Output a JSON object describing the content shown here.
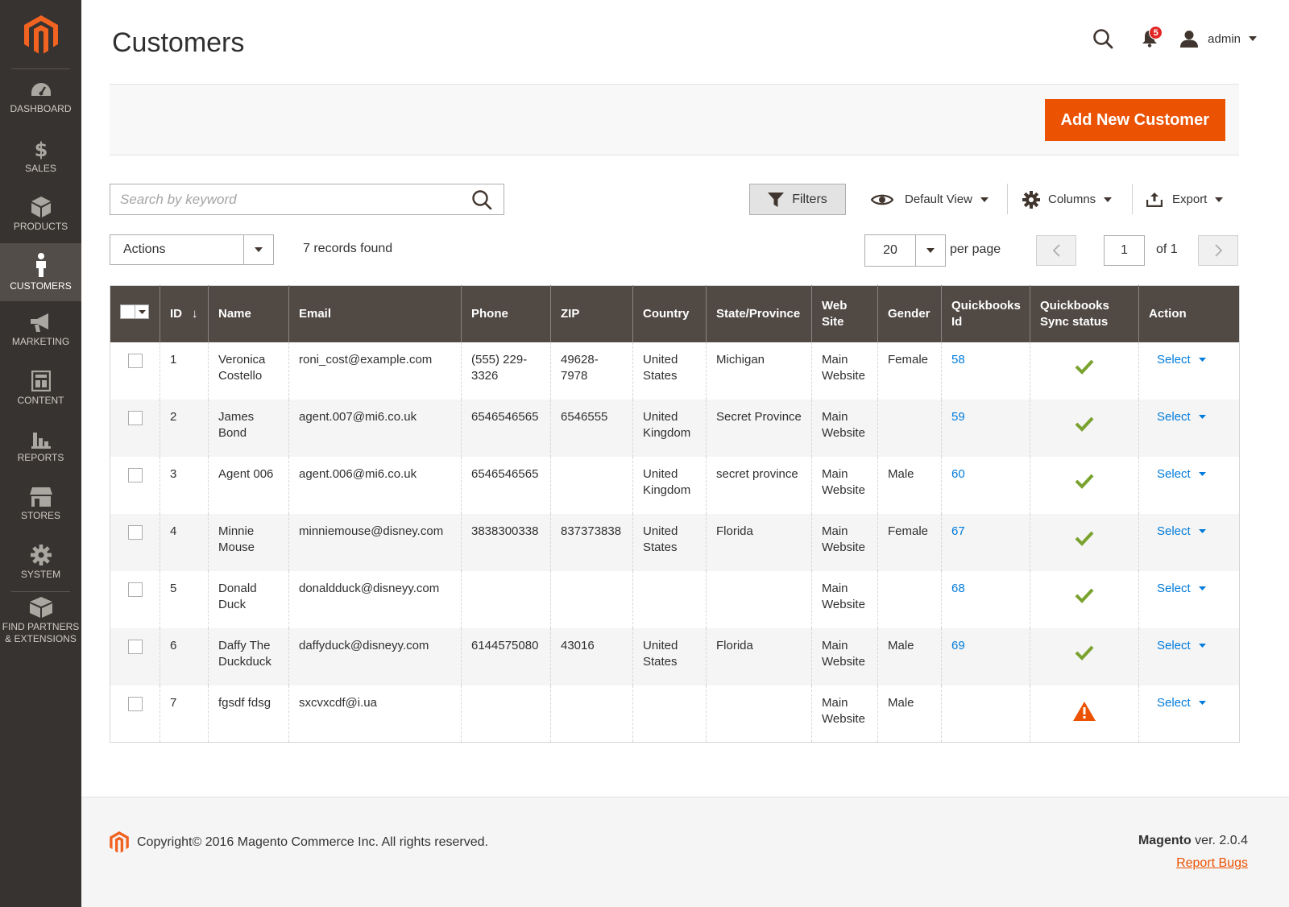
{
  "sidebar": {
    "items": [
      {
        "label": "DASHBOARD",
        "icon": "dashboard-icon"
      },
      {
        "label": "SALES",
        "icon": "dollar-icon"
      },
      {
        "label": "PRODUCTS",
        "icon": "box-icon"
      },
      {
        "label": "CUSTOMERS",
        "icon": "person-icon",
        "active": true
      },
      {
        "label": "MARKETING",
        "icon": "megaphone-icon"
      },
      {
        "label": "CONTENT",
        "icon": "layout-icon"
      },
      {
        "label": "REPORTS",
        "icon": "bar-chart-icon"
      },
      {
        "label": "STORES",
        "icon": "store-icon"
      },
      {
        "label": "SYSTEM",
        "icon": "gear-icon"
      },
      {
        "label": "FIND PARTNERS\n& EXTENSIONS",
        "icon": "partners-box-icon"
      }
    ]
  },
  "header": {
    "title": "Customers",
    "notification_count": "5",
    "user": "admin"
  },
  "action_bar": {
    "add_button": "Add New Customer"
  },
  "toolbar": {
    "search_placeholder": "Search by keyword",
    "filters": "Filters",
    "view": "Default View",
    "columns": "Columns",
    "export": "Export",
    "actions": "Actions",
    "records_found": "7 records found",
    "per_page_value": "20",
    "per_page_label": "per page",
    "current_page": "1",
    "page_of": "of 1"
  },
  "grid": {
    "columns": [
      "ID",
      "Name",
      "Email",
      "Phone",
      "ZIP",
      "Country",
      "State/Province",
      "Web Site",
      "Gender",
      "Quickbooks Id",
      "Quickbooks Sync status",
      "Action"
    ],
    "rows": [
      {
        "id": "1",
        "name": "Veronica Costello",
        "email": "roni_cost@example.com",
        "phone": "(555) 229-3326",
        "zip": "49628-7978",
        "country": "United States",
        "state": "Michigan",
        "website": "Main Website",
        "gender": "Female",
        "qb_id": "58",
        "sync": "ok",
        "action": "Select"
      },
      {
        "id": "2",
        "name": "James Bond",
        "email": "agent.007@mi6.co.uk",
        "phone": "6546546565",
        "zip": "6546555",
        "country": "United Kingdom",
        "state": "Secret Province",
        "website": "Main Website",
        "gender": "",
        "qb_id": "59",
        "sync": "ok",
        "action": "Select"
      },
      {
        "id": "3",
        "name": "Agent 006",
        "email": "agent.006@mi6.co.uk",
        "phone": "6546546565",
        "zip": "",
        "country": "United Kingdom",
        "state": "secret province",
        "website": "Main Website",
        "gender": "Male",
        "qb_id": "60",
        "sync": "ok",
        "action": "Select"
      },
      {
        "id": "4",
        "name": "Minnie Mouse",
        "email": "minniemouse@disney.com",
        "phone": "3838300338",
        "zip": "837373838",
        "country": "United States",
        "state": "Florida",
        "website": "Main Website",
        "gender": "Female",
        "qb_id": "67",
        "sync": "ok",
        "action": "Select"
      },
      {
        "id": "5",
        "name": "Donald Duck",
        "email": "donaldduck@disneyy.com",
        "phone": "",
        "zip": "",
        "country": "",
        "state": "",
        "website": "Main Website",
        "gender": "",
        "qb_id": "68",
        "sync": "ok",
        "action": "Select"
      },
      {
        "id": "6",
        "name": "Daffy The Duckduck",
        "email": "daffyduck@disneyy.com",
        "phone": "6144575080",
        "zip": "43016",
        "country": "United States",
        "state": "Florida",
        "website": "Main Website",
        "gender": "Male",
        "qb_id": "69",
        "sync": "ok",
        "action": "Select"
      },
      {
        "id": "7",
        "name": "fgsdf fdsg",
        "email": "sxcvxcdf@i.ua",
        "phone": "",
        "zip": "",
        "country": "",
        "state": "",
        "website": "Main Website",
        "gender": "Male",
        "qb_id": "",
        "sync": "warning",
        "action": "Select"
      }
    ]
  },
  "footer": {
    "copyright": "Copyright© 2016 Magento Commerce Inc. All rights reserved.",
    "brand": "Magento",
    "version": "ver. 2.0.4",
    "report_bugs": "Report Bugs"
  },
  "colors": {
    "sidebar_bg": "#373330",
    "accent": "#eb5202",
    "header_bg": "#514943",
    "link": "#007bdb",
    "success": "#79a22e",
    "warning": "#eb5202"
  }
}
